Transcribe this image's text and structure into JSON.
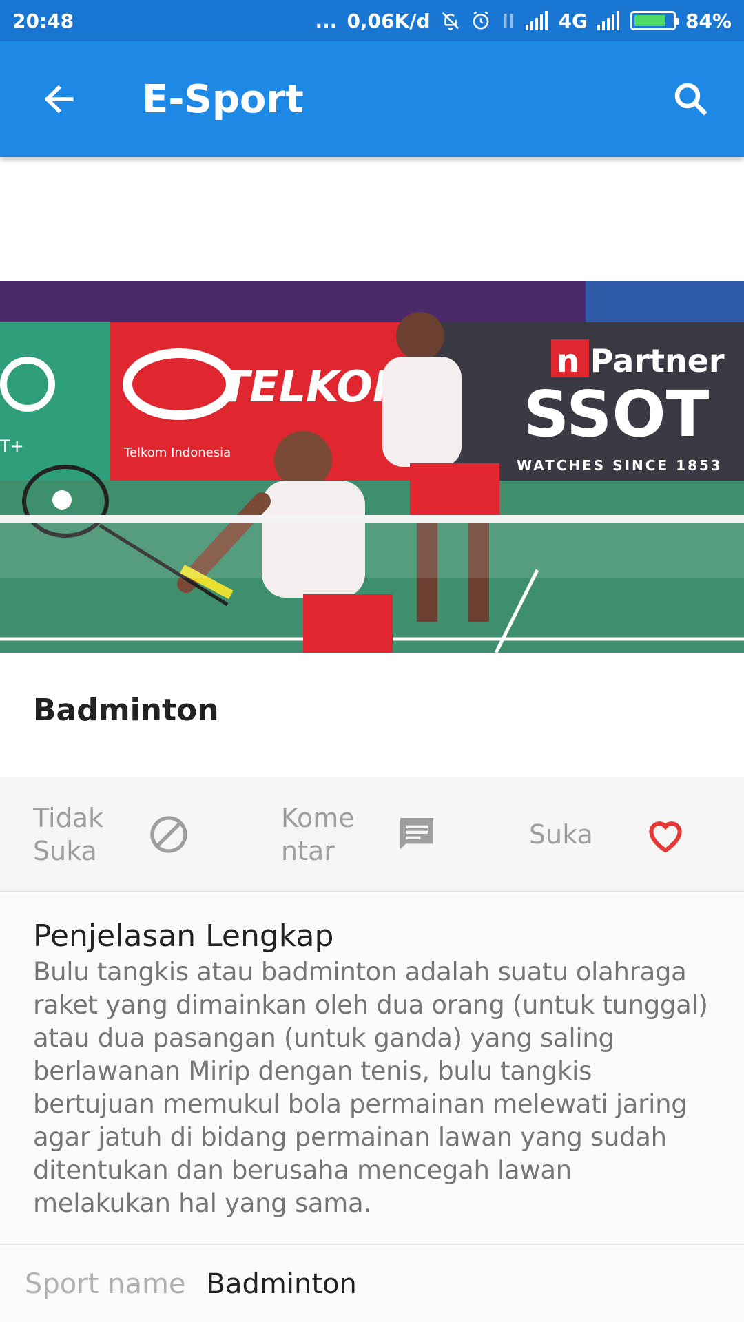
{
  "status_bar": {
    "time": "20:48",
    "dots": "...",
    "network_speed": "0,06K/d",
    "network_type": "4G",
    "battery": "84%",
    "battery_level": 0.84,
    "icons": [
      "mute-icon",
      "alarm-icon",
      "data-icon",
      "signal-icon",
      "battery-icon"
    ]
  },
  "app_bar": {
    "title": "E-Sport",
    "back_icon": "arrow-back-icon",
    "search_icon": "search-icon",
    "color": "#1e88e5"
  },
  "hero_image": {
    "description": "badminton-doubles-photo",
    "banners": [
      "TELKOMS",
      "SSOT",
      "T+",
      "n Partner",
      "Telkom Indonesia",
      "WATCHES SINCE 1853"
    ]
  },
  "item": {
    "title": "Badminton"
  },
  "actions": {
    "dislike_label": "Tidak Suka",
    "comment_label": "Kome ntar",
    "like_label": "Suka",
    "like_color": "#e53935"
  },
  "description": {
    "heading": "Penjelasan Lengkap",
    "body": "Bulu tangkis atau badminton adalah suatu olahraga raket yang dimainkan oleh dua orang (untuk tunggal) atau dua pasangan (untuk ganda) yang saling berlawanan Mirip dengan tenis, bulu tangkis bertujuan memukul bola permainan melewati jaring agar jatuh di bidang permainan lawan yang sudah ditentukan dan berusaha mencegah lawan melakukan hal yang sama."
  },
  "details": {
    "sport_name_label": "Sport name",
    "sport_name_value": "Badminton"
  }
}
